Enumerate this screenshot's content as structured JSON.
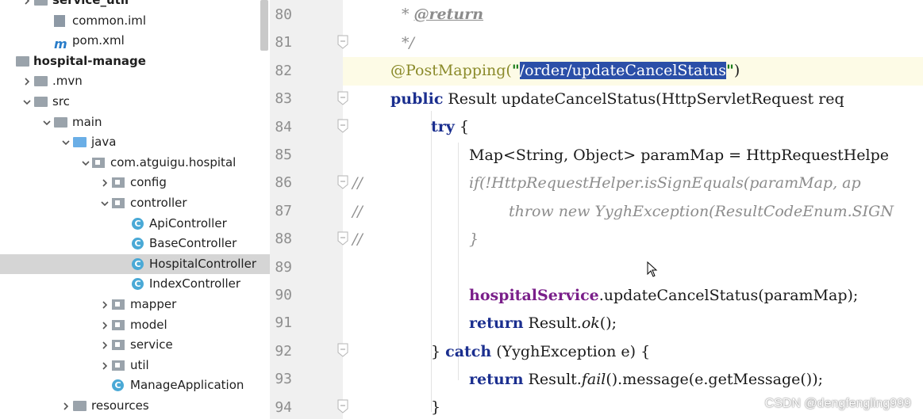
{
  "project_tree": {
    "items": [
      {
        "label": "service_util",
        "level": 1,
        "expanded": false,
        "icon": "module-folder-icon",
        "bold": true
      },
      {
        "label": "common.iml",
        "level": 2,
        "icon": "iml-file-icon"
      },
      {
        "label": "pom.xml",
        "level": 2,
        "icon": "maven-pom-icon"
      },
      {
        "label": "hospital-manage",
        "level": 0,
        "expanded": true,
        "icon": "module-folder-icon",
        "bold": true
      },
      {
        "label": ".mvn",
        "level": 1,
        "expanded": false,
        "icon": "folder-icon"
      },
      {
        "label": "src",
        "level": 1,
        "expanded": true,
        "icon": "folder-icon"
      },
      {
        "label": "main",
        "level": 2,
        "expanded": true,
        "icon": "folder-icon"
      },
      {
        "label": "java",
        "level": 3,
        "expanded": true,
        "icon": "source-folder-icon"
      },
      {
        "label": "com.atguigu.hospital",
        "level": 4,
        "expanded": true,
        "icon": "package-icon"
      },
      {
        "label": "config",
        "level": 5,
        "expanded": false,
        "icon": "package-icon"
      },
      {
        "label": "controller",
        "level": 5,
        "expanded": true,
        "icon": "package-icon"
      },
      {
        "label": "ApiController",
        "level": 6,
        "icon": "java-class-icon"
      },
      {
        "label": "BaseController",
        "level": 6,
        "icon": "java-class-icon"
      },
      {
        "label": "HospitalController",
        "level": 6,
        "icon": "java-class-icon",
        "selected": true
      },
      {
        "label": "IndexController",
        "level": 6,
        "icon": "java-class-icon"
      },
      {
        "label": "mapper",
        "level": 5,
        "expanded": false,
        "icon": "package-icon"
      },
      {
        "label": "model",
        "level": 5,
        "expanded": false,
        "icon": "package-icon"
      },
      {
        "label": "service",
        "level": 5,
        "expanded": false,
        "icon": "package-icon"
      },
      {
        "label": "util",
        "level": 5,
        "expanded": false,
        "icon": "package-icon"
      },
      {
        "label": "ManageApplication",
        "level": 5,
        "icon": "spring-boot-class-icon"
      },
      {
        "label": "resources",
        "level": 3,
        "expanded": false,
        "icon": "resources-folder-icon"
      }
    ]
  },
  "editor": {
    "line_numbers": [
      "80",
      "81",
      "82",
      "83",
      "84",
      "85",
      "86",
      "87",
      "88",
      "89",
      "90",
      "91",
      "92",
      "93",
      "94"
    ],
    "lines": {
      "l80_star": "* ",
      "l80_tag": "@return",
      "l81": "*/",
      "l82_ann": "@PostMapping(",
      "l82_q1": "\"",
      "l82_str": "/order/updateCancelStatus",
      "l82_q2": "\"",
      "l82_end": ")",
      "l83_kw": "public",
      "l83_rest": " Result updateCancelStatus(HttpServletRequest req",
      "l84_kw": "try",
      "l84_rest": " {",
      "l85": "Map<String, Object> paramMap = HttpRequestHelpe",
      "l86_cm": "//",
      "l86": "if(!HttpRequestHelper.isSignEquals(paramMap, ap",
      "l87_cm": "//",
      "l87": "throw new YyghException(ResultCodeEnum.SIGN",
      "l88_cm": "//",
      "l88": "}",
      "l90_fld": "hospitalService",
      "l90_rest": ".updateCancelStatus(paramMap);",
      "l91_kw": "return",
      "l91_pre": " Result.",
      "l91_it": "ok",
      "l91_end": "();",
      "l92_pre": "} ",
      "l92_kw": "catch",
      "l92_rest": " (YyghException e) {",
      "l93_kw": "return",
      "l93_pre": " Result.",
      "l93_it": "fail",
      "l93_end": "().message(e.getMessage());",
      "l94": "}"
    }
  },
  "watermark": "CSDN @dengfengling999",
  "colors": {
    "keyword": "#1b2f8f",
    "annotation": "#8a8a2a",
    "string": "#1b7d1b",
    "comment": "#8c8c8c",
    "field": "#7a1f8a",
    "selection": "#2b4fa8",
    "current_line": "#fdfbe6"
  }
}
